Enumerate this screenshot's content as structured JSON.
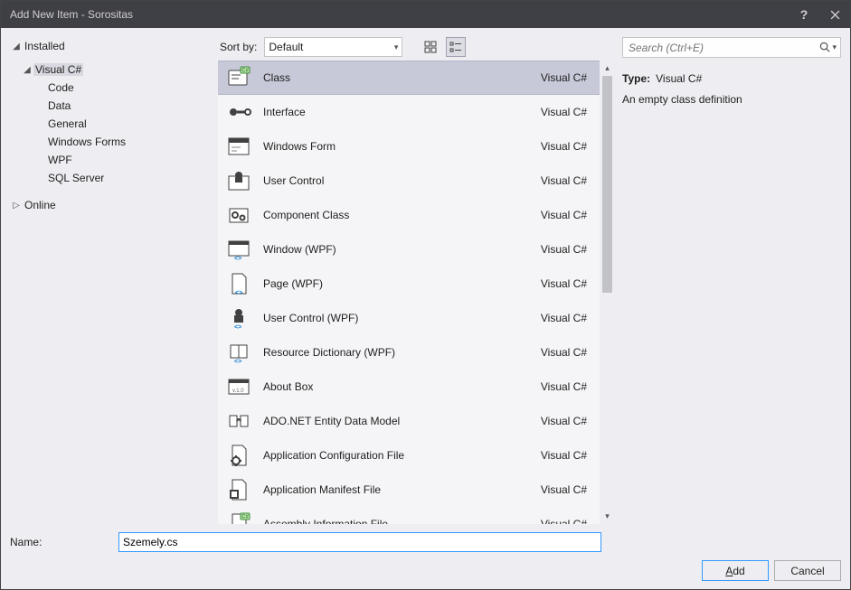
{
  "window": {
    "title": "Add New Item - Sorositas"
  },
  "sidebar": {
    "installed": "Installed",
    "online": "Online",
    "lang": "Visual C#",
    "cats": [
      "Code",
      "Data",
      "General",
      "Windows Forms",
      "WPF",
      "SQL Server"
    ]
  },
  "toolbar": {
    "sort_label": "Sort by:",
    "sort_value": "Default"
  },
  "search": {
    "placeholder": "Search (Ctrl+E)"
  },
  "detail": {
    "type_label": "Type:",
    "type_value": "Visual C#",
    "description": "An empty class definition"
  },
  "name_field": {
    "label": "Name:",
    "value": "Szemely.cs"
  },
  "buttons": {
    "add": "Add",
    "cancel": "Cancel"
  },
  "lang_tag": "Visual C#",
  "templates": [
    {
      "name": "Class",
      "icon": "class",
      "selected": true
    },
    {
      "name": "Interface",
      "icon": "interface"
    },
    {
      "name": "Windows Form",
      "icon": "winform"
    },
    {
      "name": "User Control",
      "icon": "usercontrol"
    },
    {
      "name": "Component Class",
      "icon": "component"
    },
    {
      "name": "Window (WPF)",
      "icon": "window-wpf"
    },
    {
      "name": "Page (WPF)",
      "icon": "page-wpf"
    },
    {
      "name": "User Control (WPF)",
      "icon": "uc-wpf"
    },
    {
      "name": "Resource Dictionary (WPF)",
      "icon": "resdict"
    },
    {
      "name": "About Box",
      "icon": "about"
    },
    {
      "name": "ADO.NET Entity Data Model",
      "icon": "ado"
    },
    {
      "name": "Application Configuration File",
      "icon": "appconfig"
    },
    {
      "name": "Application Manifest File",
      "icon": "manifest"
    },
    {
      "name": "Assembly Information File",
      "icon": "asm"
    }
  ]
}
